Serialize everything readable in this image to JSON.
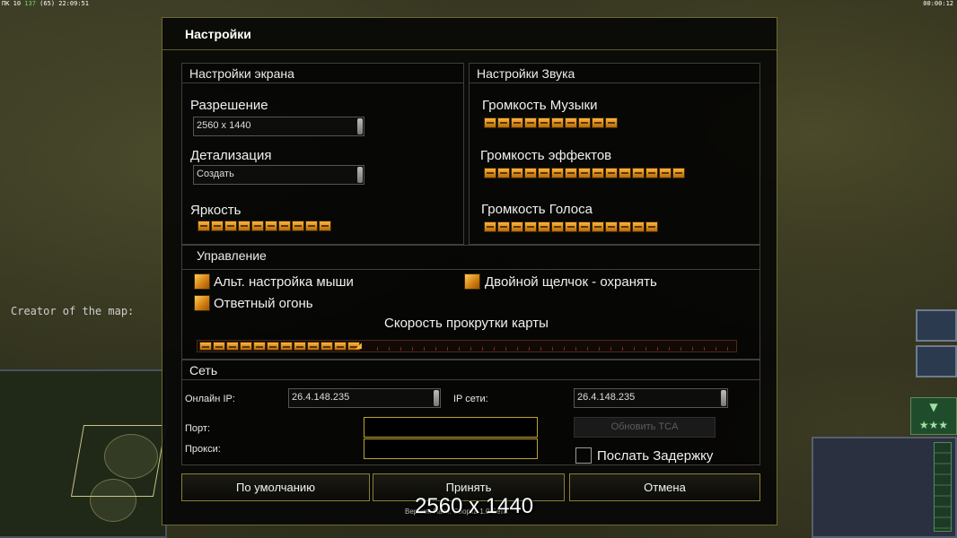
{
  "hud": {
    "left_fps": "ПК 10",
    "left_green": "137",
    "left_count": "(65)",
    "left_time": "22:09:51",
    "right_time": "00:00:12"
  },
  "map": {
    "creator_label": "Creator of the map:"
  },
  "dialog": {
    "title": "Настройки",
    "screen": {
      "header": "Настройки экрана",
      "resolution_label": "Разрешение",
      "resolution_value": "2560 x 1440",
      "detail_label": "Детализация",
      "detail_value": "Создать",
      "brightness_label": "Яркость",
      "brightness_level": 10
    },
    "sound": {
      "header": "Настройки Звука",
      "music_label": "Громкость Музыки",
      "music_level": 10,
      "effects_label": "Громкость эффектов",
      "effects_level": 15,
      "voice_label": "Громкость Голоса",
      "voice_level": 13
    },
    "control": {
      "header": "Управление",
      "alt_mouse_label": "Альт. настройка мыши",
      "alt_mouse_checked": true,
      "double_click_label": "Двойной щелчок - охранять",
      "double_click_checked": true,
      "return_fire_label": "Ответный огонь",
      "return_fire_checked": true,
      "scroll_label": "Скорость прокрутки карты",
      "scroll_level": 12,
      "scroll_max": 43
    },
    "network": {
      "header": "Сеть",
      "online_ip_label": "Онлайн IP:",
      "online_ip_value": "26.4.148.235",
      "lan_ip_label": "IP сети:",
      "lan_ip_value": "26.4.148.235",
      "port_label": "Порт:",
      "port_value": "",
      "proxy_label": "Прокси:",
      "proxy_value": "",
      "update_tca_label": "Обновить TCA",
      "send_delay_label": "Послать Задержку",
      "send_delay_checked": false
    },
    "buttons": {
      "default": "По умолчанию",
      "accept": "Принять",
      "cancel": "Отмена"
    },
    "version_text": "Версия: Патч: Сборка 1.0 Бета"
  },
  "overlay": {
    "resolution_text": "2560 x 1440"
  },
  "colors": {
    "accent": "#ffb43a",
    "frame": "#6d6a30",
    "button_border": "#8a7f3a"
  }
}
